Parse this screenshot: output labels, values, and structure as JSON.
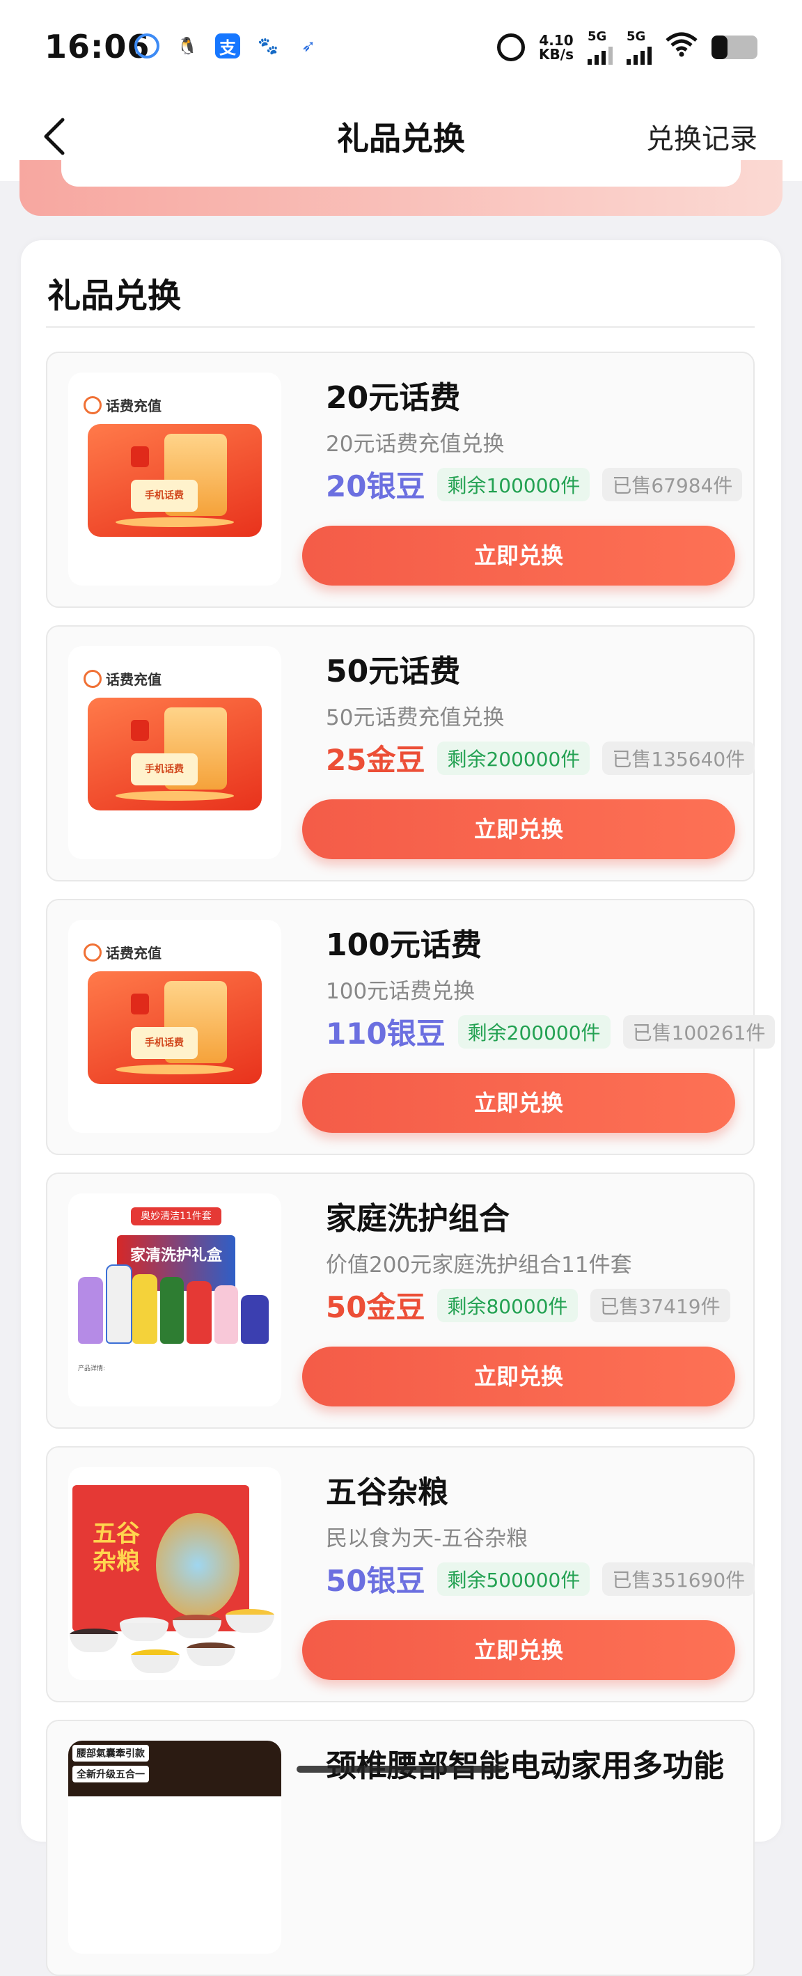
{
  "status_bar": {
    "time": "16:06",
    "speed_value": "4.10",
    "speed_unit": "KB/s",
    "net1": "5G",
    "net2": "5G",
    "battery_level": 0.35,
    "app_icons": [
      "browser-icon",
      "qq-icon",
      "alipay-icon",
      "baidu-icon",
      "bird-app-icon"
    ]
  },
  "header": {
    "title": "礼品兑换",
    "right_link": "兑换记录"
  },
  "panel": {
    "title": "礼品兑换"
  },
  "colors": {
    "button": "#f45c48",
    "silver": "#6b6fe0",
    "gold": "#ec4e36",
    "remain_tag": "#23a152"
  },
  "thumb_texts": {
    "recharge_badge": "话费充值",
    "phone_label": "手机话费",
    "kit_banner": "奥妙清洁11件套",
    "kit_box": "家清洗护礼盒",
    "kit_fine": "产品详情:",
    "grain_text": "五谷杂粮",
    "massage_1": "腰部氣囊牽引款",
    "massage_2": "全新升级五合一"
  },
  "items": [
    {
      "title": "20元话费",
      "desc": "20元话费充值兑换",
      "price": "20银豆",
      "currency": "silver",
      "remain": "剩余100000件",
      "sold": "已售67984件",
      "button": "立即兑换"
    },
    {
      "title": "50元话费",
      "desc": "50元话费充值兑换",
      "price": "25金豆",
      "currency": "gold",
      "remain": "剩余200000件",
      "sold": "已售135640件",
      "button": "立即兑换"
    },
    {
      "title": "100元话费",
      "desc": "100元话费兑换",
      "price": "110银豆",
      "currency": "silver",
      "remain": "剩余200000件",
      "sold": "已售100261件",
      "button": "立即兑换"
    },
    {
      "title": "家庭洗护组合",
      "desc": "价值200元家庭洗护组合11件套",
      "price": "50金豆",
      "currency": "gold",
      "remain": "剩余80000件",
      "sold": "已售37419件",
      "button": "立即兑换"
    },
    {
      "title": "五谷杂粮",
      "desc": "民以食为天-五谷杂粮",
      "price": "50银豆",
      "currency": "silver",
      "remain": "剩余500000件",
      "sold": "已售351690件",
      "button": "立即兑换"
    },
    {
      "title": "颈椎腰部智能电动家用多功能"
    }
  ]
}
